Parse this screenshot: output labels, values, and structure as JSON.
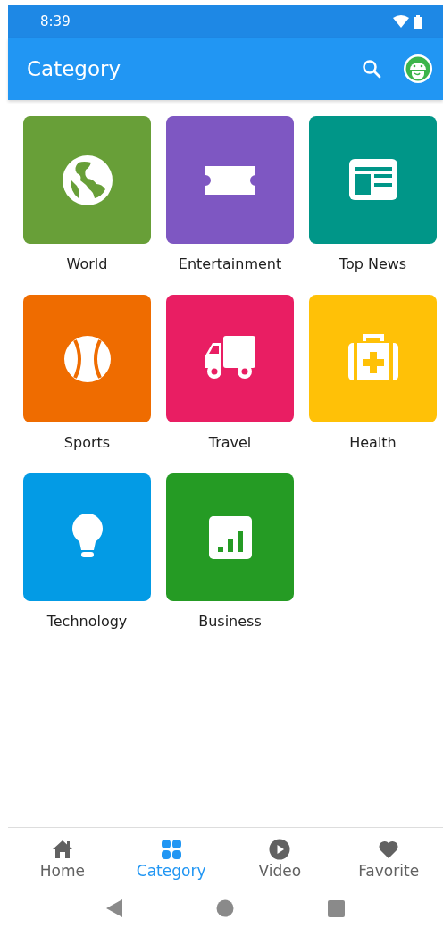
{
  "status_bar": {
    "time": "8:39"
  },
  "app_bar": {
    "title": "Category"
  },
  "categories": [
    {
      "label": "World",
      "color": "#689f38"
    },
    {
      "label": "Entertainment",
      "color": "#7e57c2"
    },
    {
      "label": "Top News",
      "color": "#009688"
    },
    {
      "label": "Sports",
      "color": "#ef6c00"
    },
    {
      "label": "Travel",
      "color": "#e91e63"
    },
    {
      "label": "Health",
      "color": "#ffc107"
    },
    {
      "label": "Technology",
      "color": "#039be5"
    },
    {
      "label": "Business",
      "color": "#259b24"
    }
  ],
  "bottom_nav": [
    {
      "label": "Home",
      "selected": false
    },
    {
      "label": "Category",
      "selected": true
    },
    {
      "label": "Video",
      "selected": false
    },
    {
      "label": "Favorite",
      "selected": false
    }
  ]
}
